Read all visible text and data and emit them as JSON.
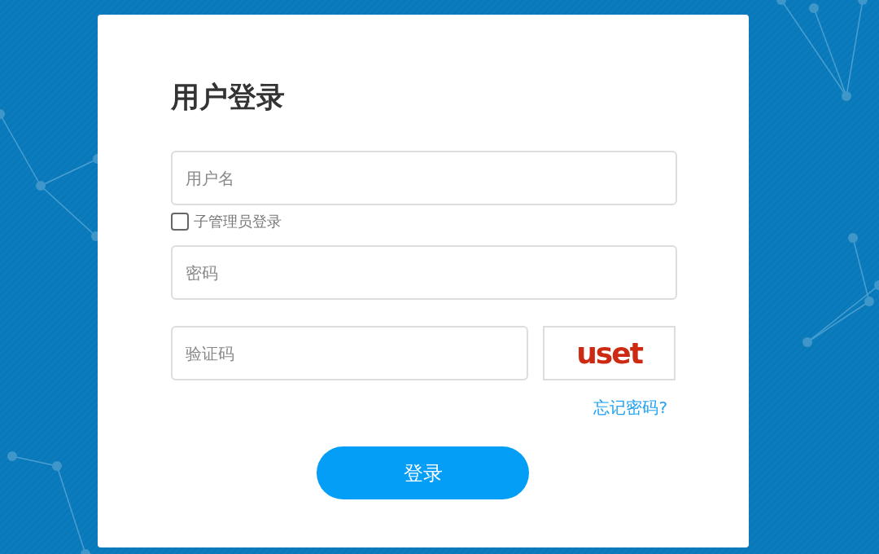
{
  "login_form": {
    "title": "用户登录",
    "username": {
      "placeholder": "用户名"
    },
    "sub_admin": {
      "label": "子管理员登录",
      "checked": false
    },
    "password": {
      "placeholder": "密码"
    },
    "captcha": {
      "placeholder": "验证码",
      "code": "uset"
    },
    "forgot_link": "忘记密码?",
    "submit_button": "登录"
  }
}
